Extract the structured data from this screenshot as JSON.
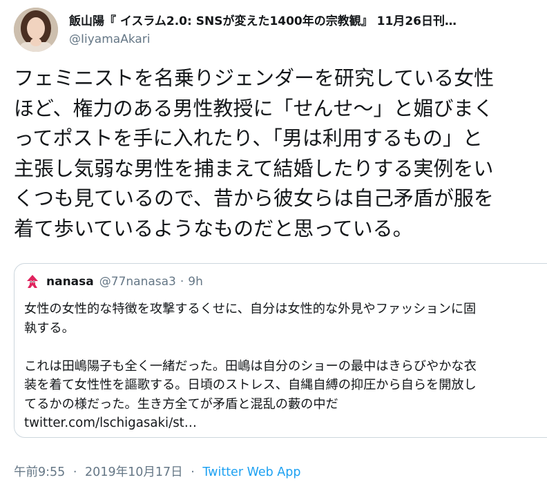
{
  "author": {
    "display_name": "飯山陽『 イスラム2.0: SNSが変えた1400年の宗教観』 11月26日刊…",
    "handle": "@IiyamaAkari",
    "avatar_icon": "profile-photo"
  },
  "tweet": {
    "text": "フェミニストを名乗りジェンダーを研究している女性\nほど、権力のある男性教授に「せんせ～」と媚びまく\nってポストを手に入れたり、「男は利用するもの」と\n主張し気弱な男性を捕まえて結婚したりする実例をい\nくつも見ているので、昔から彼女らは自己矛盾が服を\n着て歩いているようなものだと思っている。"
  },
  "quote": {
    "name": "nanasa",
    "handle": "@77nanasa3",
    "separator": "·",
    "time": "9h",
    "avatar_icon": "squid-icon",
    "para1": "女性の女性的な特徴を攻撃するくせに、自分は女性的な外見やファッションに固\n執する。",
    "para2": "これは田嶋陽子も全く一緒だった。田嶋は自分のショーの最中はきらびやかな衣\n装を着て女性性を謳歌する。日頃のストレス、自縄自縛の抑圧から自らを開放し\nてるかの様だった。生き方全てが矛盾と混乱の藪の中だ",
    "link": "twitter.com/lschigasaki/st…"
  },
  "meta": {
    "time": "午前9:55",
    "separator": "·",
    "date": "2019年10月17日",
    "app": "Twitter Web App"
  },
  "colors": {
    "text": "#14171a",
    "secondary": "#657786",
    "accent": "#1da1f2",
    "border": "#ccd6dd",
    "squid": "#e0245e"
  }
}
